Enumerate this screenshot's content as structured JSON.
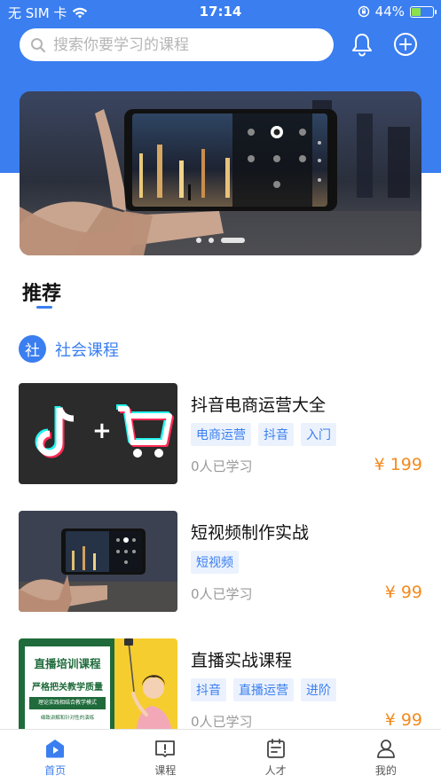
{
  "status_bar": {
    "carrier": "无 SIM 卡",
    "time": "17:14",
    "battery": "44%",
    "battery_level": 0.44
  },
  "header": {
    "search_placeholder": "搜索你要学习的课程"
  },
  "banner": {
    "slide_count": 3,
    "active_slide": 3
  },
  "section": {
    "title": "推荐"
  },
  "category": {
    "badge": "社",
    "name": "社会课程"
  },
  "courses": [
    {
      "title": "抖音电商运营大全",
      "tags": [
        "电商运营",
        "抖音",
        "入门"
      ],
      "learners": "0人已学习",
      "price": "¥ 199"
    },
    {
      "title": "短视频制作实战",
      "tags": [
        "短视频"
      ],
      "learners": "0人已学习",
      "price": "¥ 99"
    },
    {
      "title": "直播实战课程",
      "tags": [
        "抖音",
        "直播运营",
        "进阶"
      ],
      "learners": "0人已学习",
      "price": "¥ 99"
    }
  ],
  "live_poster": {
    "headline": "直播培训课程",
    "subline": "严格把关教学质量",
    "box1": "理论实践相结合教学模式",
    "box2": "细致讲解和针对性的演练"
  },
  "tab_bar": {
    "tabs": [
      {
        "label": "首页",
        "active": true
      },
      {
        "label": "课程",
        "active": false
      },
      {
        "label": "人才",
        "active": false
      },
      {
        "label": "我的",
        "active": false
      }
    ]
  },
  "colors": {
    "primary": "#3a7ef0",
    "price": "#f28a1f",
    "tag_bg": "#ebf2fd"
  }
}
